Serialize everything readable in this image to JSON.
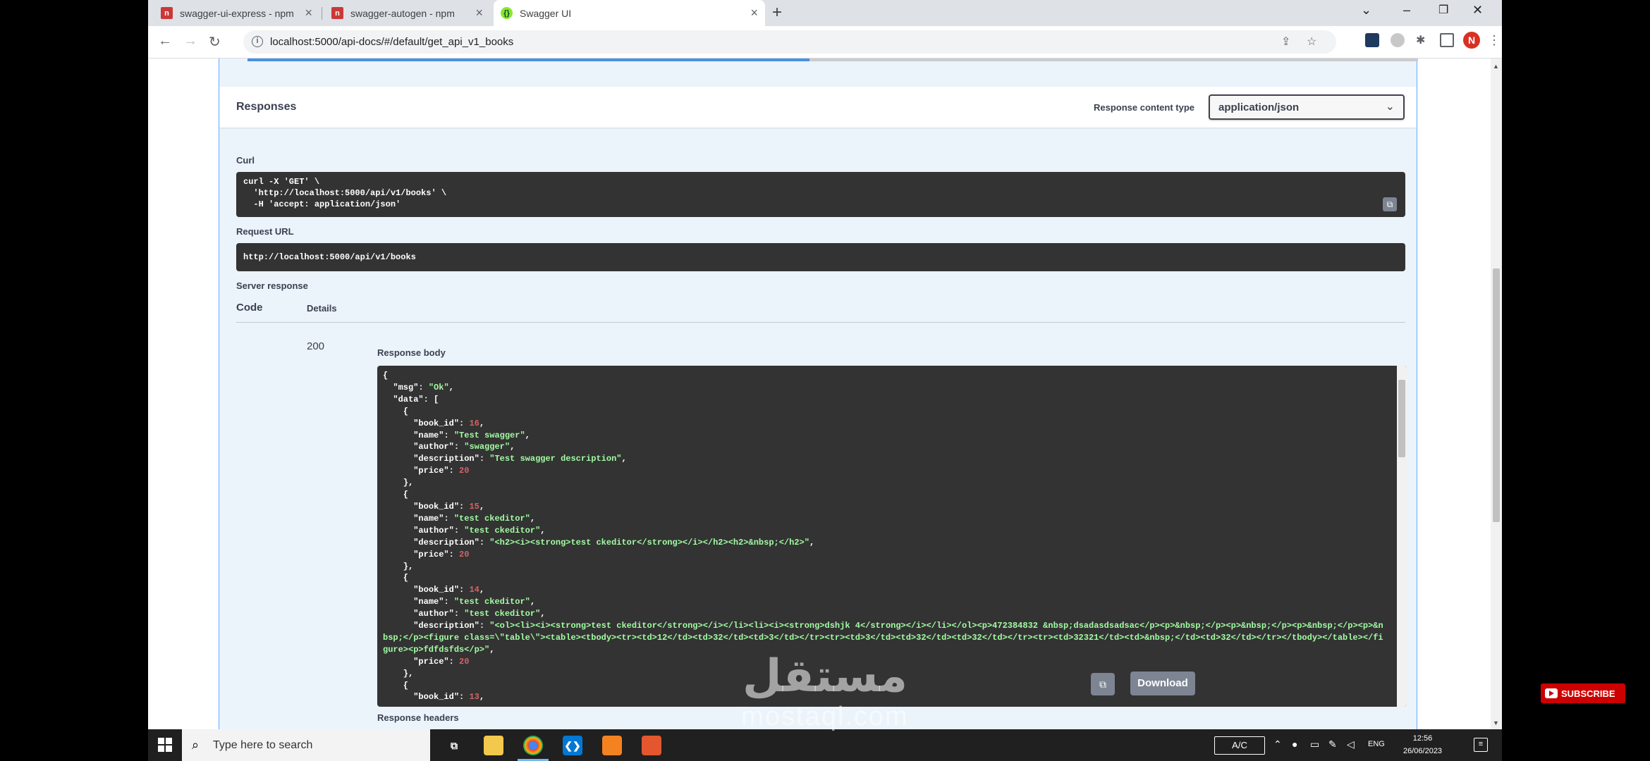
{
  "browser": {
    "tabs": [
      {
        "title": "swagger-ui-express - npm",
        "icon": "npm-icon",
        "active": false
      },
      {
        "title": "swagger-autogen - npm",
        "icon": "npm-icon",
        "active": false
      },
      {
        "title": "Swagger UI",
        "icon": "swagger-icon",
        "active": true
      }
    ],
    "new_tab": "+",
    "url": "localhost:5000/api-docs/#/default/get_api_v1_books"
  },
  "swagger": {
    "responses_title": "Responses",
    "content_type_label": "Response content type",
    "content_type_value": "application/json",
    "curl_label": "Curl",
    "curl_command": "curl -X 'GET' \\\n  'http://localhost:5000/api/v1/books' \\\n  -H 'accept: application/json'",
    "request_url_label": "Request URL",
    "request_url": "http://localhost:5000/api/v1/books",
    "server_response_label": "Server response",
    "code_header": "Code",
    "details_header": "Details",
    "status_code": "200",
    "response_body_label": "Response body",
    "response_body": {
      "msg": "Ok",
      "books": [
        {
          "book_id": "16",
          "name": "Test swagger",
          "author": "swagger",
          "description": "Test swagger description",
          "price": "20"
        },
        {
          "book_id": "15",
          "name": "test ckeditor",
          "author": "test ckeditor",
          "description": "<h2><i><strong>test ckeditor</strong></i></h2><h2>&nbsp;</h2>",
          "price": "20"
        },
        {
          "book_id": "14",
          "name": "test ckeditor",
          "author": "test ckeditor",
          "description": "<ol><li><i><strong>test ckeditor</strong></i></li><li><i><strong>dshjk 4</strong></i></li></ol><p>472384832 &nbsp;dsadasdsadsac</p><p>&nbsp;</p><p>&nbsp;</p><p>&nbsp;</p><p>&nbsp;</p><figure class=\\\"table\\\"><table><tbody><tr><td>12</td><td>32</td><td>3</td></tr><tr><td>3</td><td>32</td><td>32</td></tr><tr><td>32321</td><td>&nbsp;</td><td>32</td></tr></tbody></table></figure><p>fdfdsfds</p>",
          "price": "20"
        }
      ],
      "next_book_id": "13"
    },
    "download_label": "Download",
    "response_headers_label": "Response headers"
  },
  "taskbar": {
    "search_placeholder": "Type here to search",
    "input_indicator": "A/C",
    "language": "ENG",
    "time": "12:56",
    "date": "26/06/2023"
  },
  "overlay": {
    "subscribe": "SUBSCRIBE",
    "watermark_arabic": "مستقل",
    "watermark_latin": "mostaql.com"
  },
  "colors": {
    "swagger_code_bg": "#333333",
    "json_string": "#a2fca2",
    "json_number": "#d36363",
    "get_blue": "#61affe",
    "taskbar": "#202020"
  }
}
